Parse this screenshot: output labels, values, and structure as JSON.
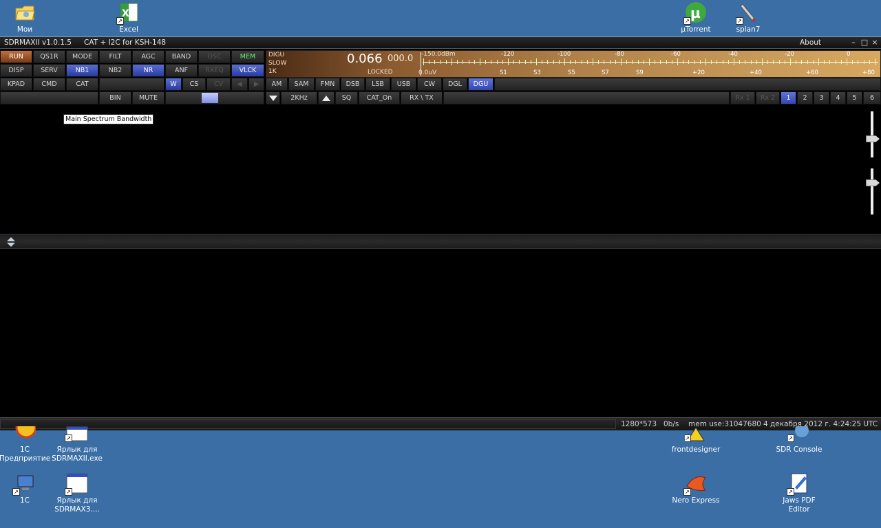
{
  "desktop": {
    "top_icons": [
      {
        "label": "Мои"
      },
      {
        "label": "Excel"
      },
      {
        "label": "µTorrent"
      },
      {
        "label": "splan7"
      }
    ],
    "bottom_icons": [
      {
        "label": "1С Предприятие"
      },
      {
        "label": "Ярлык для SDRMAXII.exe"
      },
      {
        "label": "frontdesigner"
      },
      {
        "label": "SDR Console"
      },
      {
        "label": "1С"
      },
      {
        "label": "Ярлык для SDRMAX3...."
      },
      {
        "label": "Nero Express"
      },
      {
        "label": "Jaws PDF Editor"
      }
    ]
  },
  "window": {
    "title": "SDRMAXII v1.0.1.5",
    "subtitle": "CAT  + I2C for  KSH-148",
    "about": "About",
    "controls": {
      "minimize": "–",
      "maximize": "□",
      "close": "×"
    }
  },
  "buttons": {
    "row1": [
      "RUN",
      "QS1R",
      "MODE",
      "FILT",
      "AGC",
      "BAND",
      "OSC",
      "MEM"
    ],
    "row2": [
      "DISP",
      "SERV",
      "NB1",
      "NB2",
      "NR",
      "ANF",
      "RXEQ",
      "VLCK"
    ],
    "row3": [
      "KPAD",
      "CMD",
      "CAT",
      "W",
      "CS",
      "CV",
      "◀",
      "▶"
    ],
    "row4": [
      "BIN",
      "MUTE"
    ],
    "modes": [
      "AM",
      "SAM",
      "FMN",
      "DSB",
      "LSB",
      "USB",
      "CW",
      "DGL",
      "DGU"
    ],
    "controls": [
      "2KHz",
      "SQ",
      "CAT_On",
      "RX \\ TX"
    ],
    "rx": [
      "Rx 1",
      "Rx 2"
    ],
    "channels": [
      "1",
      "2",
      "3",
      "4",
      "5",
      "6"
    ]
  },
  "meter": {
    "mode": "DIGU",
    "agc": "SLOW",
    "filter": "1K",
    "frequency": "0.066",
    "frequency_sub": "000.0",
    "status": "LOCKED",
    "dbm_label": "-150.0dBm",
    "uv_label": "0.0uV",
    "dbm_scale": [
      "-120",
      "-100",
      "-80",
      "-60",
      "-40",
      "-20",
      "0"
    ],
    "s_scale": [
      "S1",
      "S3",
      "S5",
      "S7",
      "S9",
      "+20",
      "+40",
      "+60",
      "+80"
    ]
  },
  "tooltip": "Main Spectrum Bandwidth",
  "status": {
    "resolution": "1280*573",
    "rate": "0b/s",
    "mem": "mem use:31047680",
    "datetime": "4 декабря 2012 г. 4:24:25 UTC"
  },
  "colors": {
    "desktop": "#3a6ea5",
    "run": "#c07040",
    "active": "#5a6fd0",
    "mem": "#6cf06c"
  }
}
